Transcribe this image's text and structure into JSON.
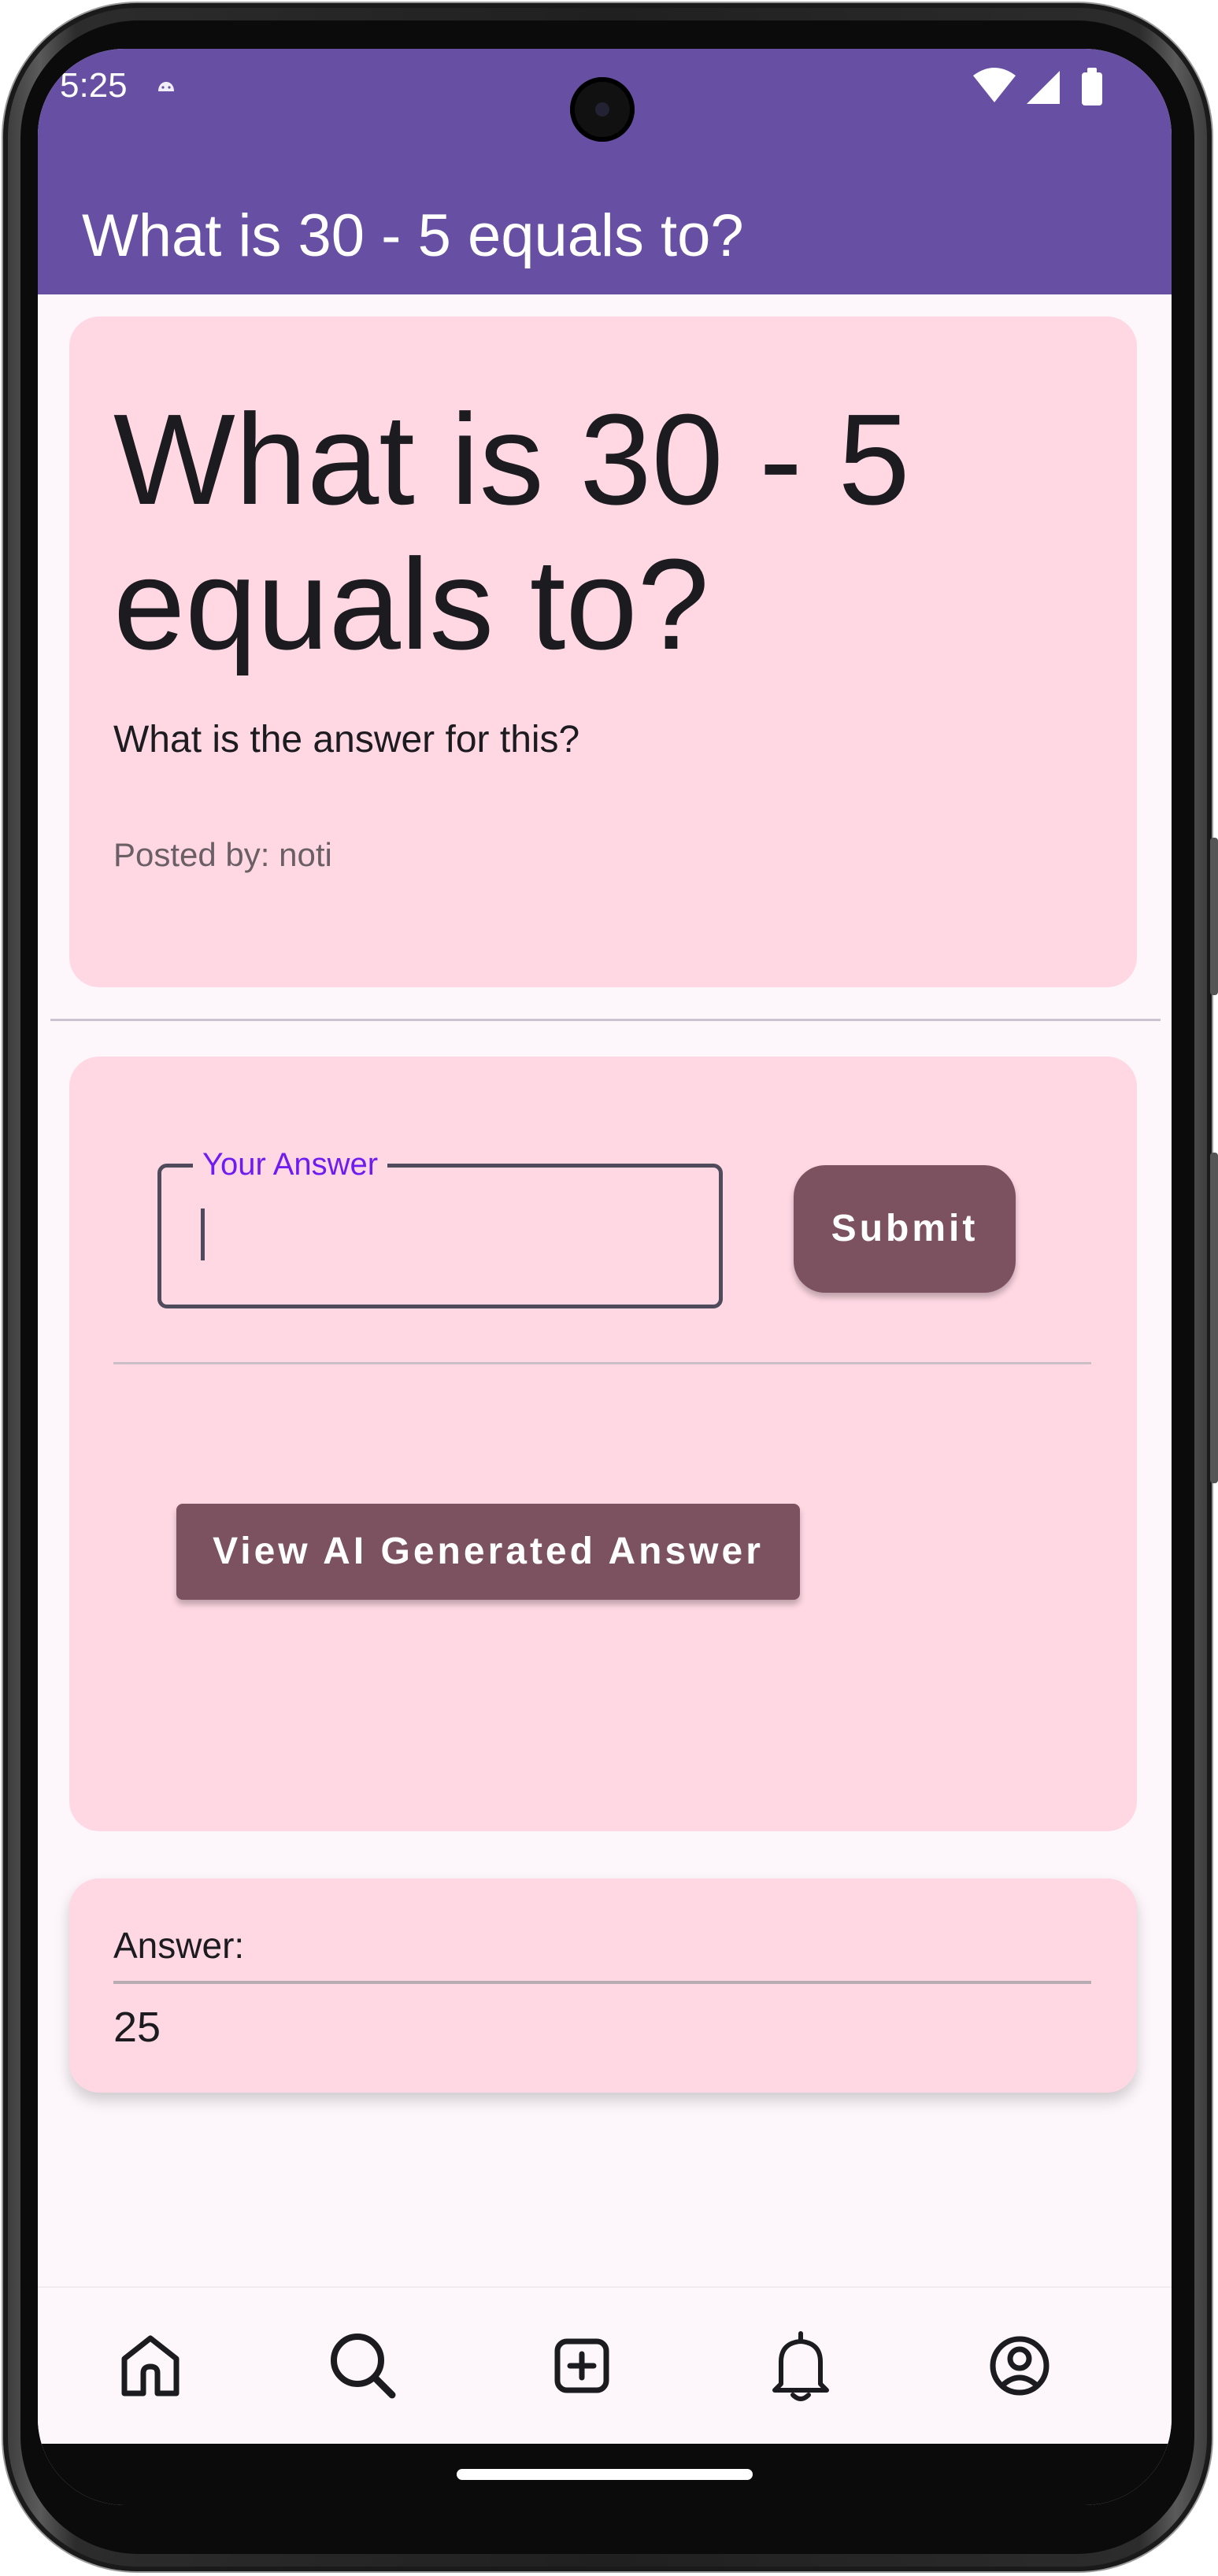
{
  "status_bar": {
    "time": "5:25"
  },
  "app_bar": {
    "title": "What is 30 - 5 equals to?",
    "color": "#6750a4"
  },
  "question": {
    "title": "What is 30 - 5 equals to?",
    "body": "What is the answer for this?",
    "posted_by": "Posted by: noti"
  },
  "answer_form": {
    "field_label": "Your Answer",
    "field_value": "",
    "submit_label": "Submit",
    "ai_button_label": "View AI Generated Answer"
  },
  "result": {
    "label": "Answer:",
    "value": "25"
  },
  "bottom_nav": {
    "items": [
      "home-icon",
      "search-icon",
      "add-icon",
      "notifications-icon",
      "profile-icon"
    ]
  },
  "colors": {
    "card": "#ffd8e4",
    "button": "#7d5260",
    "label_accent": "#6e1cf0",
    "background": "#fdf7fb"
  }
}
